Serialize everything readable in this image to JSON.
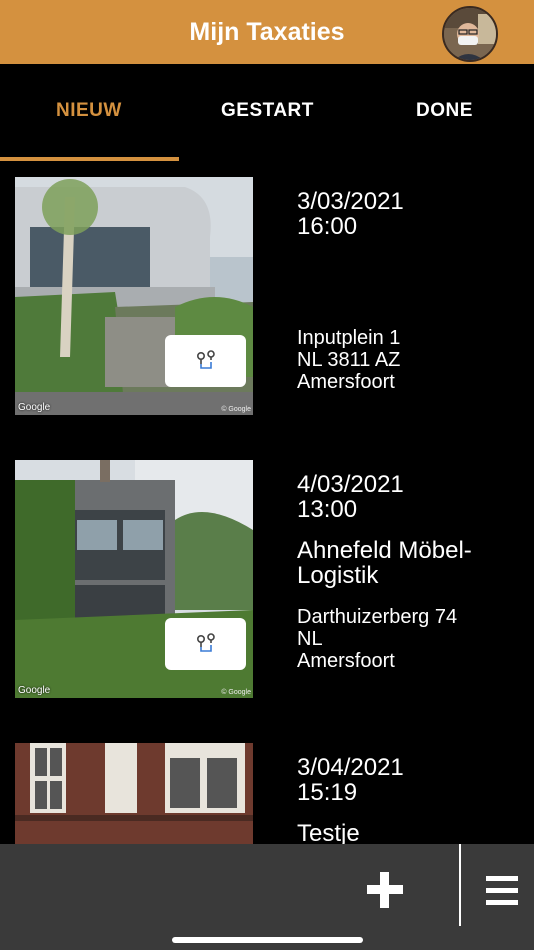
{
  "header": {
    "title": "Mijn Taxaties"
  },
  "tabs": [
    {
      "label": "NIEUW",
      "active": true
    },
    {
      "label": "GESTART",
      "active": false
    },
    {
      "label": "DONE",
      "active": false
    }
  ],
  "appointments": [
    {
      "date": "3/03/2021",
      "time": "16:00",
      "name": "",
      "address_line1": "Inputplein 1",
      "address_line2": "NL 3811 AZ",
      "city": "Amersfoort",
      "map_credit": "Google",
      "map_copyright": "© Google"
    },
    {
      "date": "4/03/2021",
      "time": "13:00",
      "name": "Ahnefeld Möbel-Logistik",
      "address_line1": "Darthuizerberg 74",
      "address_line2": "NL",
      "city": "Amersfoort",
      "map_credit": "Google",
      "map_copyright": "© Google"
    },
    {
      "date": "3/04/2021",
      "time": "15:19",
      "name": "Testje"
    }
  ],
  "icons": {
    "route": "route-map-pin-icon",
    "add": "plus-icon",
    "menu": "hamburger-menu-icon"
  },
  "colors": {
    "accent": "#D4913F",
    "background": "#000000",
    "bottom_bar": "#3a3a3a"
  }
}
